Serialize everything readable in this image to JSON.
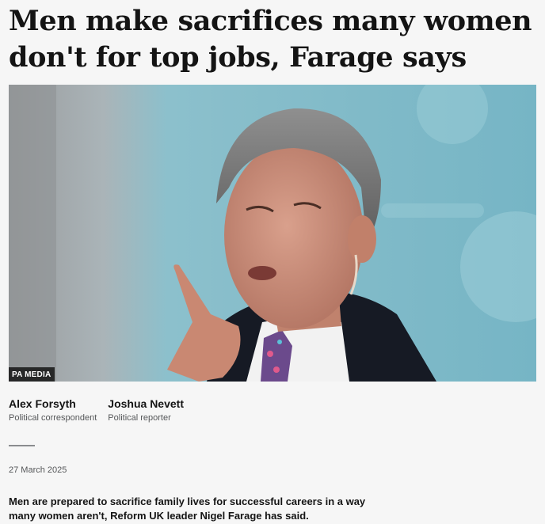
{
  "article": {
    "headline": "Men make sacrifices many women don't for top jobs, Farage says",
    "image_credit": "PA MEDIA",
    "authors": [
      {
        "name": "Alex Forsyth",
        "role": "Political correspondent"
      },
      {
        "name": "Joshua Nevett",
        "role": "Political reporter"
      }
    ],
    "date": "27 March 2025",
    "lead": "Men are prepared to sacrifice family lives for successful careers in a way many women aren't, Reform UK leader Nigel Farage has said."
  },
  "colors": {
    "page_background": "#f6f6f6",
    "text": "#141414",
    "secondary_text": "#545658",
    "photo_backdrop": "#7fb6c4"
  }
}
